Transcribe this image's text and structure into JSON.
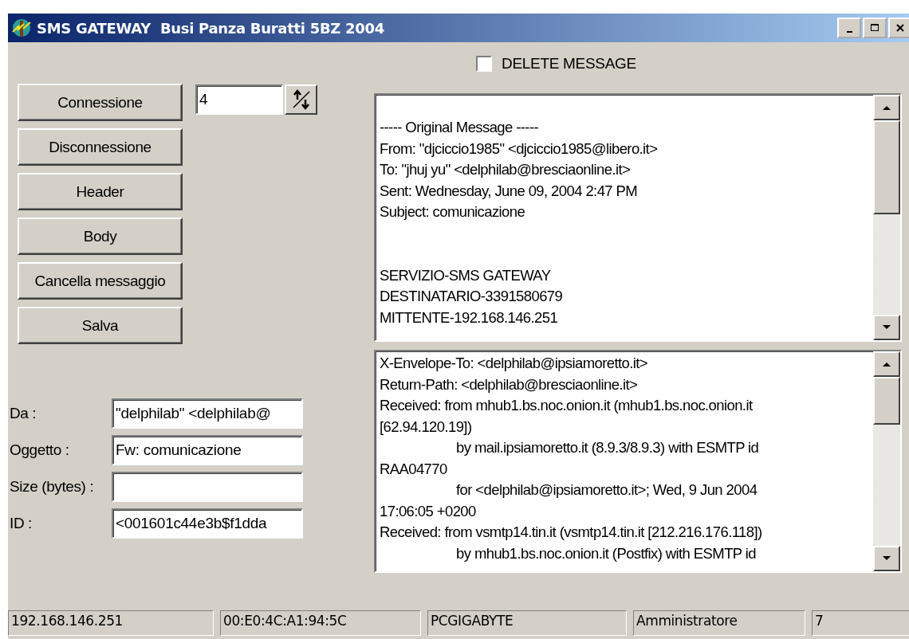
{
  "window": {
    "title": "SMS GATEWAY  Busi Panza Buratti 5BZ 2004"
  },
  "delete_message": {
    "label": "DELETE MESSAGE",
    "checked": false
  },
  "buttons": [
    "Connessione",
    "Disconnessione",
    "Header",
    "Body",
    "Cancella messaggio",
    "Salva"
  ],
  "spin_field": {
    "value": "4"
  },
  "fields": [
    {
      "label": "Da :",
      "value": "\"delphilab\" <delphilab@"
    },
    {
      "label": "Oggetto :",
      "value": "Fw: comunicazione"
    },
    {
      "label": "Size (bytes) :"
    },
    {
      "label": "ID :",
      "value": "<001601c44e3b$f1dda"
    }
  ],
  "body_memo": {
    "paragraphs": [
      [
        "----- Original Message -----",
        "From: \"djciccio1985\" <djciccio1985@libero.it>",
        "To: \"jhuj yu\" <delphilab@bresciaonline.it>",
        "Sent: Wednesday, June 09, 2004 2:47 PM",
        "Subject: comunicazione"
      ],
      [
        "SERVIZIO-SMS GATEWAY",
        "DESTINATARIO-3391580679",
        "MITTENTE-192.168.146.251"
      ]
    ]
  },
  "header_memo": {
    "lines": [
      {
        "text": "X-Envelope-To: <delphilab@ipsiamoretto.it>",
        "indent": false
      },
      {
        "text": "Return-Path: <delphilab@bresciaonline.it>",
        "indent": false
      },
      {
        "text": "Received: from mhub1.bs.noc.onion.it (mhub1.bs.noc.onion.it",
        "indent": false
      },
      {
        "text": "[62.94.120.19])",
        "indent": false
      },
      {
        "text": "by mail.ipsiamoretto.it (8.9.3/8.9.3) with ESMTP id",
        "indent": true
      },
      {
        "text": "RAA04770",
        "indent": false
      },
      {
        "text": "for <delphilab@ipsiamoretto.it>; Wed, 9 Jun 2004",
        "indent": true
      },
      {
        "text": "17:06:05 +0200",
        "indent": false
      },
      {
        "text": "Received: from vsmtp14.tin.it (vsmtp14.tin.it [212.216.176.118])",
        "indent": false
      },
      {
        "text": "by mhub1.bs.noc.onion.it (Postfix) with ESMTP id",
        "indent": true
      }
    ]
  },
  "status_bar": [
    "192.168.146.251",
    "00:E0:4C:A1:94:5C",
    "PCGIGABYTE",
    "Amministratore",
    "7"
  ]
}
